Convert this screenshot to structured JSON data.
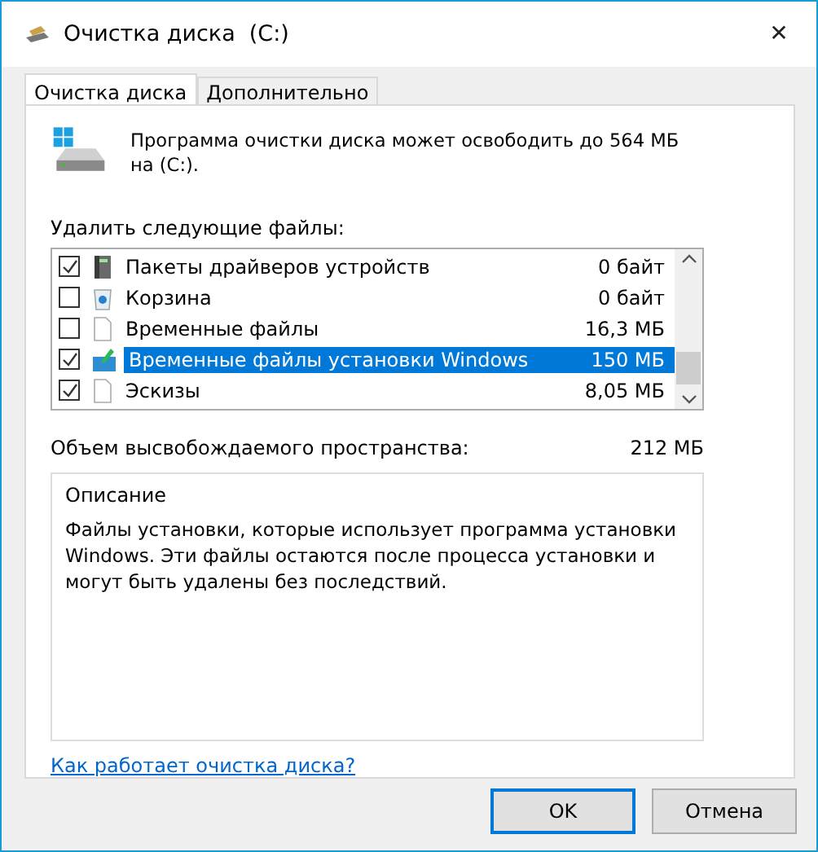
{
  "window": {
    "title": "Очистка диска  (C:)",
    "close": "✕"
  },
  "tabs": [
    {
      "label": "Очистка диска",
      "selected": true
    },
    {
      "label": "Дополнительно",
      "selected": false
    }
  ],
  "intro": "Программа очистки диска может освободить до 564 МБ на (C:).",
  "files_label": "Удалить следующие файлы:",
  "files": [
    {
      "kind": "driver",
      "name": "Пакеты драйверов устройств",
      "size": "0 байт",
      "checked": true,
      "selected": false
    },
    {
      "kind": "bin",
      "name": "Корзина",
      "size": "0 байт",
      "checked": false,
      "selected": false
    },
    {
      "kind": "file",
      "name": "Временные файлы",
      "size": "16,3 МБ",
      "checked": false,
      "selected": false
    },
    {
      "kind": "setup",
      "name": "Временные файлы установки Windows",
      "size": "150 МБ",
      "checked": true,
      "selected": true
    },
    {
      "kind": "file",
      "name": "Эскизы",
      "size": "8,05 МБ",
      "checked": true,
      "selected": false
    }
  ],
  "total": {
    "label": "Объем высвобождаемого пространства:",
    "value": "212 МБ"
  },
  "description": {
    "title": "Описание",
    "text": "Файлы установки, которые использует программа установки Windows.  Эти файлы остаются после процесса установки и могут быть удалены без последствий."
  },
  "link": "Как работает очистка диска?",
  "buttons": [
    {
      "label": "OK",
      "default": true
    },
    {
      "label": "Отмена",
      "default": false
    }
  ]
}
